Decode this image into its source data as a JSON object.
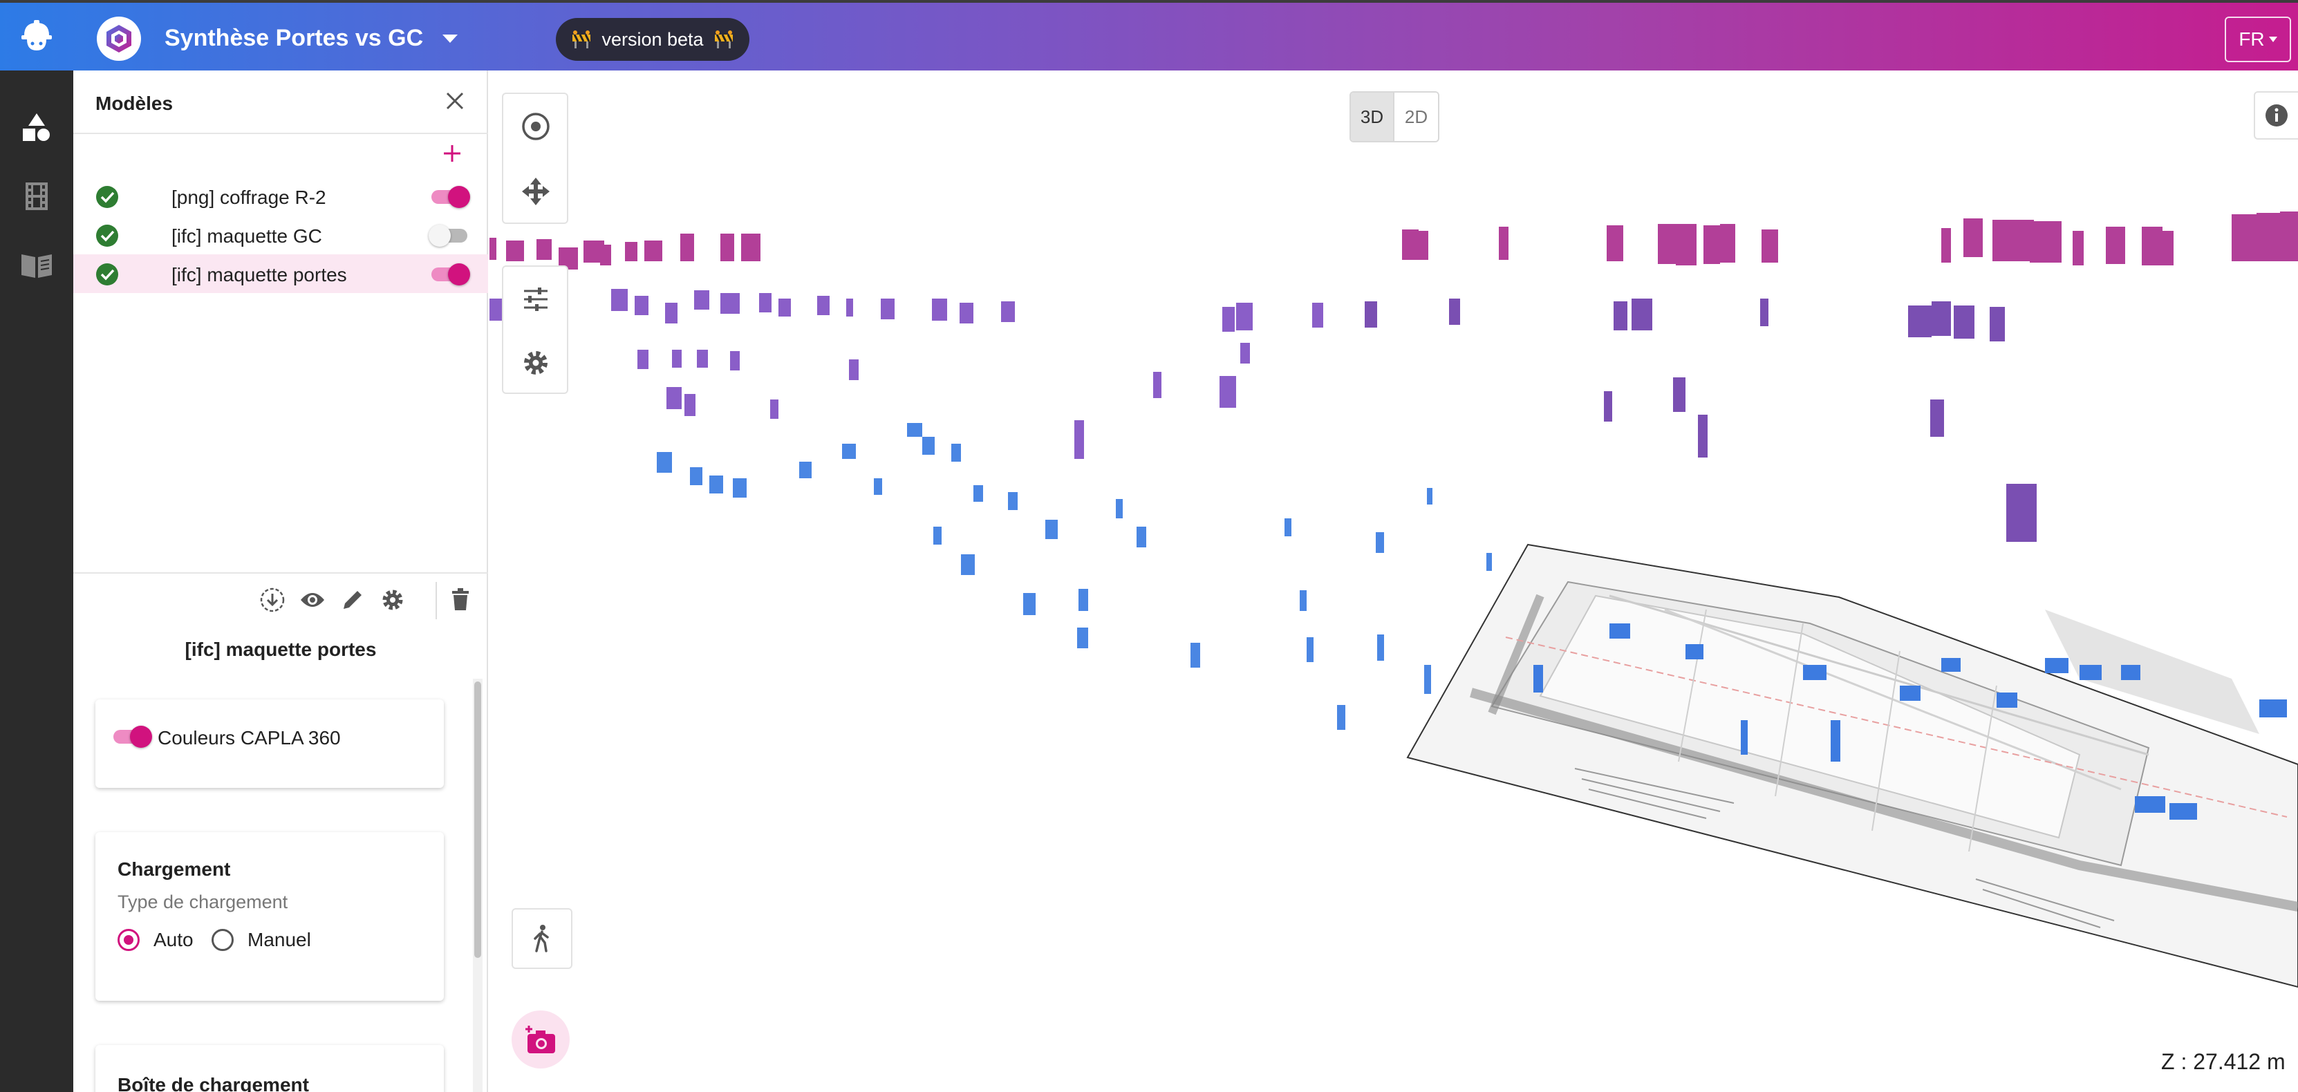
{
  "app": {
    "title": "Synthèse Portes vs GC",
    "beta_label": "version beta",
    "language": "FR"
  },
  "icons": {
    "home": "helmet-logo-icon",
    "app_logo": "cube-logo-icon",
    "beta": "construction-barrier-icon",
    "rail": [
      "shapes-icon",
      "film-icon",
      "book-icon"
    ]
  },
  "panel": {
    "title": "Modèles",
    "models": [
      {
        "label": "[png] coffrage R-2",
        "loaded": true,
        "visible": true,
        "selected": false
      },
      {
        "label": "[ifc] maquette GC",
        "loaded": true,
        "visible": false,
        "selected": false
      },
      {
        "label": "[ifc] maquette portes",
        "loaded": true,
        "visible": true,
        "selected": true
      }
    ],
    "selected_model": "[ifc] maquette portes",
    "colors_card": {
      "label": "Couleurs CAPLA 360",
      "enabled": true
    },
    "loading_card": {
      "title": "Chargement",
      "subtitle": "Type de chargement",
      "options": [
        "Auto",
        "Manuel"
      ],
      "selected": "Auto"
    },
    "loading_box_title": "Boîte de chargement"
  },
  "viewer": {
    "view_modes": [
      "3D",
      "2D"
    ],
    "active_view_mode": "3D",
    "z_readout": "Z : 27.412 m"
  },
  "colors": {
    "accent": "#d1127e",
    "success": "#2e7d32",
    "rail_bg": "#2b2b2b",
    "door_blue": "#3d7be0",
    "door_violet": "#8a5ec8",
    "door_magenta": "#b23f98"
  }
}
